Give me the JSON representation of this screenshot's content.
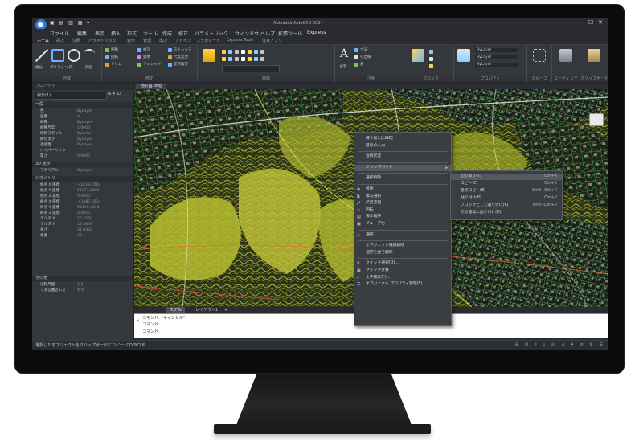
{
  "window": {
    "title": "Autodesk AutoCAD 2024",
    "controls": [
      "—",
      "☐",
      "✕"
    ],
    "quick_access": "▣ ▤ ▥ ▦ ▾"
  },
  "menu": [
    "ファイル",
    "編集",
    "表示",
    "挿入",
    "形式",
    "ツール",
    "作成",
    "修正",
    "パラメトリック",
    "ウィンドウ",
    "ヘルプ",
    "拡張ツール",
    "Express"
  ],
  "ribbon_tabs": [
    "ホーム",
    "挿入",
    "注釈",
    "パラメトリック",
    "表示",
    "管理",
    "出力",
    "アドイン",
    "コラボレート",
    "Express Tools",
    "注目アプリ"
  ],
  "ribbon_groups": [
    "作成",
    "修正",
    "画層",
    "注釈",
    "ブロック",
    "プロパティ",
    "グループ",
    "ユーティリティ",
    "クリップボード",
    "ビュー"
  ],
  "ribbon_samples": {
    "draw": [
      "線分",
      "ポリライン",
      "円",
      "円弧"
    ],
    "modify": [
      "移動",
      "回転",
      "トリム",
      "複写",
      "鏡像",
      "フィレット",
      "ストレッチ",
      "尺度変更",
      "配列複写"
    ],
    "props": [
      "ByLayer",
      "ByLayer",
      "ByLayer"
    ],
    "annotation": [
      "文字",
      "寸法",
      "引出線",
      "表"
    ]
  },
  "panel": {
    "header": "プロパティ",
    "selection": "線分(1)",
    "sel_buttons": "⊞ ✦ ⊡",
    "sections": [
      "一般",
      "3D 表示",
      "ジオメトリ",
      "その他"
    ],
    "general": [
      [
        "色",
        "ByLayer"
      ],
      [
        "画層",
        "0"
      ],
      [
        "線種",
        "ByLayer"
      ],
      [
        "線種尺度",
        "1.0000"
      ],
      [
        "印刷スタイル",
        "ByColor"
      ],
      [
        "線の太さ",
        "ByLayer"
      ],
      [
        "透過性",
        "ByLayer"
      ],
      [
        "ハイパーリンク",
        ""
      ],
      [
        "厚さ",
        "0.0000"
      ]
    ],
    "view3d": [
      [
        "マテリアル",
        "ByLayer"
      ]
    ],
    "geometry": [
      [
        "始点 X 座標",
        "-42013.2564"
      ],
      [
        "始点 Y 座標",
        "51273.8806"
      ],
      [
        "始点 Z 座標",
        "0.0000"
      ],
      [
        "終点 X 座標",
        "-41987.0014"
      ],
      [
        "終点 Y 座標",
        "51290.4415"
      ],
      [
        "終点 Z 座標",
        "0.0000"
      ],
      [
        "デルタ X",
        "26.2550"
      ],
      [
        "デルタ Y",
        "16.5609"
      ],
      [
        "長さ",
        "31.0432"
      ],
      [
        "角度",
        "32"
      ]
    ],
    "misc": [
      [
        "注釈尺度",
        "1:1"
      ],
      [
        "寸法位置合わせ",
        "有効"
      ]
    ]
  },
  "drawing_tab": "地形図.dwg",
  "layout_tabs": [
    "モデル",
    "レイアウト1",
    "+"
  ],
  "context_menu": {
    "items": [
      {
        "label": "繰り返し[LINE]",
        "icon": ""
      },
      {
        "label": "最近の入力",
        "icon": ""
      },
      {
        "label": "",
        "sep": true
      },
      {
        "label": "注釈尺度",
        "icon": ""
      },
      {
        "label": "",
        "sep": true
      },
      {
        "label": "クリップボード",
        "icon": "",
        "sub": true,
        "hl": true
      },
      {
        "label": "",
        "sep": true
      },
      {
        "label": "選択解除",
        "icon": ""
      },
      {
        "label": "",
        "sep": true
      },
      {
        "label": "移動",
        "icon": "✥"
      },
      {
        "label": "複写選択",
        "icon": "⧉"
      },
      {
        "label": "尺度変更",
        "icon": "⤢"
      },
      {
        "label": "回転",
        "icon": "↻"
      },
      {
        "label": "表示順序",
        "icon": "▤"
      },
      {
        "label": "グループ化",
        "icon": "▣"
      },
      {
        "label": "",
        "sep": true
      },
      {
        "label": "選択",
        "icon": "◇"
      },
      {
        "label": "",
        "sep": true
      },
      {
        "label": "オブジェクト選択解除",
        "icon": ""
      },
      {
        "label": "選択を全て解除",
        "icon": ""
      },
      {
        "label": "",
        "sep": true
      },
      {
        "label": "クイック選択(Q)...",
        "icon": "⚲"
      },
      {
        "label": "クイック計算",
        "icon": "▦"
      },
      {
        "label": "文字検索(F)...",
        "icon": "⌕"
      },
      {
        "label": "オブジェクト プロパティ管理(S)",
        "icon": "☰"
      }
    ]
  },
  "submenu": [
    {
      "label": "切り取り(T)",
      "shortcut": "Ctrl+X"
    },
    {
      "label": "コピー(C)",
      "shortcut": "Ctrl+C"
    },
    {
      "label": "基点コピー(B)",
      "shortcut": "Shift+Ctrl+C"
    },
    {
      "label": "貼り付け(P)",
      "shortcut": "Ctrl+V"
    },
    {
      "label": "ブロックとして貼り付け(K)",
      "shortcut": "Shift+Ctrl+V"
    },
    {
      "label": "元の座標に貼り付け(D)",
      "shortcut": ""
    }
  ],
  "command_lines": [
    "コマンド: *キャンセル*",
    "コマンド:",
    "コマンド:"
  ],
  "status_text": "選択したオブジェクトをクリップボードにコピー: COPYCLIP",
  "status_icons": "⊞ ▥ ⌗ ⟂ ◎ ⊿ ✦ ≡ ⚙ ☰"
}
